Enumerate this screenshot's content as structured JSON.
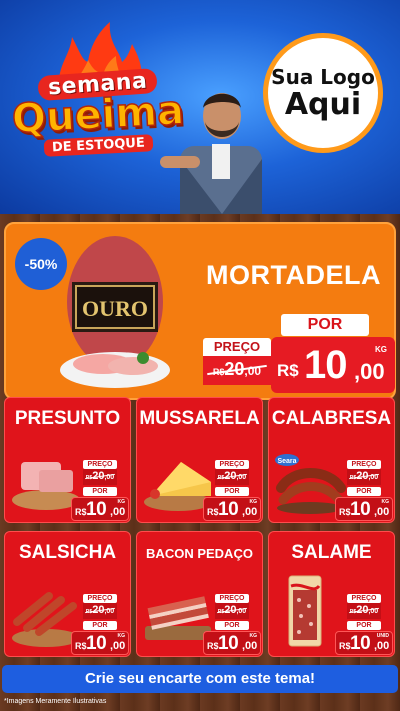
{
  "header": {
    "brand_line1": "semana",
    "brand_line2": "Queima",
    "brand_line3": "DE ESTOQUE",
    "logo_line1": "Sua Logo",
    "logo_line2": "Aqui"
  },
  "featured": {
    "discount": "-50%",
    "name": "MORTADELA",
    "product_brand": "OURO",
    "preco_label": "PREÇO",
    "old_currency": "R$",
    "old_int": "20",
    "old_cents": ",00",
    "por_label": "POR",
    "currency": "R$",
    "price_int": "10",
    "price_cents": ",00",
    "unit": "KG"
  },
  "products": [
    {
      "name": "PRESUNTO",
      "preco": "PREÇO",
      "old_rs": "R$",
      "old_int": "20",
      "old_c": ",00",
      "por": "POR",
      "rs": "R$",
      "int": "10",
      "c": ",00",
      "unit": "KG"
    },
    {
      "name": "MUSSARELA",
      "preco": "PREÇO",
      "old_rs": "R$",
      "old_int": "20",
      "old_c": ",00",
      "por": "POR",
      "rs": "R$",
      "int": "10",
      "c": ",00",
      "unit": "KG"
    },
    {
      "name": "CALABRESA",
      "brand": "Seara",
      "preco": "PREÇO",
      "old_rs": "R$",
      "old_int": "20",
      "old_c": ",00",
      "por": "POR",
      "rs": "R$",
      "int": "10",
      "c": ",00",
      "unit": "KG"
    },
    {
      "name": "SALSICHA",
      "preco": "PREÇO",
      "old_rs": "R$",
      "old_int": "20",
      "old_c": ",00",
      "por": "POR",
      "rs": "R$",
      "int": "10",
      "c": ",00",
      "unit": "KG"
    },
    {
      "name": "BACON PEDAÇO",
      "preco": "PREÇO",
      "old_rs": "R$",
      "old_int": "20",
      "old_c": ",00",
      "por": "POR",
      "rs": "R$",
      "int": "10",
      "c": ",00",
      "unit": "KG"
    },
    {
      "name": "SALAME",
      "preco": "PREÇO",
      "old_rs": "R$",
      "old_int": "20",
      "old_c": ",00",
      "por": "POR",
      "rs": "R$",
      "int": "10",
      "c": ",00",
      "unit": "UNID"
    }
  ],
  "footer": {
    "cta": "Crie seu encarte com este tema!",
    "disclaimer": "*Imagens Meramente Ilustrativas"
  },
  "colors": {
    "header_blue": "#1d63d8",
    "featured_orange": "#f47c10",
    "card_red": "#e0141b",
    "cta_blue": "#1e5ee0",
    "accent_yellow": "#ffb400"
  },
  "icons": [
    "flame-icon",
    "mortadela-image",
    "presunto-image",
    "mussarela-image",
    "calabresa-image",
    "salsicha-image",
    "bacon-image",
    "salame-image",
    "person-image"
  ]
}
